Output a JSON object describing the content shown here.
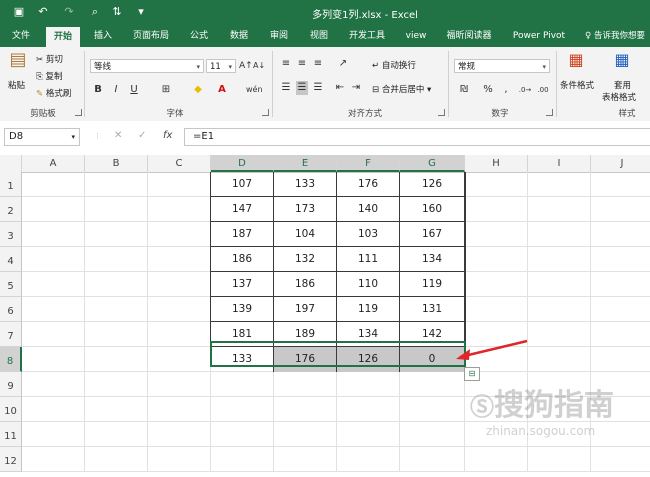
{
  "app": {
    "title": "多列变1列.xlsx  -  Excel",
    "accent": "#217346"
  },
  "tabs": [
    "文件",
    "开始",
    "插入",
    "页面布局",
    "公式",
    "数据",
    "审阅",
    "视图",
    "开发工具",
    "view",
    "福昕阅读器",
    "Power Pivot"
  ],
  "tell_me": "告诉我你想要",
  "ribbon": {
    "clipboard": {
      "paste": "粘贴",
      "cut": "剪切",
      "copy": "复制",
      "format_painter": "格式刷",
      "label": "剪贴板"
    },
    "font": {
      "name": "等线",
      "size": "11",
      "label": "字体",
      "bold": "B",
      "italic": "I",
      "underline": "U"
    },
    "alignment": {
      "wrap": "自动换行",
      "merge": "合并后居中",
      "label": "对齐方式"
    },
    "number": {
      "format": "常规",
      "label": "数字"
    },
    "styles": {
      "conditional": "条件格式",
      "table_fmt_1": "套用",
      "table_fmt_2": "表格格式",
      "label": "样式"
    }
  },
  "formula_bar": {
    "name_box": "D8",
    "fx": "fx",
    "formula": "=E1",
    "cancel": "✕",
    "enter": "✓"
  },
  "columns": [
    "A",
    "B",
    "C",
    "D",
    "E",
    "F",
    "G",
    "H",
    "I",
    "J"
  ],
  "rows": [
    "1",
    "2",
    "3",
    "4",
    "5",
    "6",
    "7",
    "8",
    "9",
    "10",
    "11",
    "12"
  ],
  "table": [
    [
      "107",
      "133",
      "176",
      "126"
    ],
    [
      "147",
      "173",
      "140",
      "160"
    ],
    [
      "187",
      "104",
      "103",
      "167"
    ],
    [
      "186",
      "132",
      "111",
      "134"
    ],
    [
      "137",
      "186",
      "110",
      "119"
    ],
    [
      "139",
      "197",
      "119",
      "131"
    ],
    [
      "181",
      "189",
      "134",
      "142"
    ],
    [
      "133",
      "176",
      "126",
      "0"
    ]
  ],
  "watermark": {
    "main": "搜狗指南",
    "sub": "zhinan.sogou.com"
  },
  "annotation_color": "#e0262b"
}
